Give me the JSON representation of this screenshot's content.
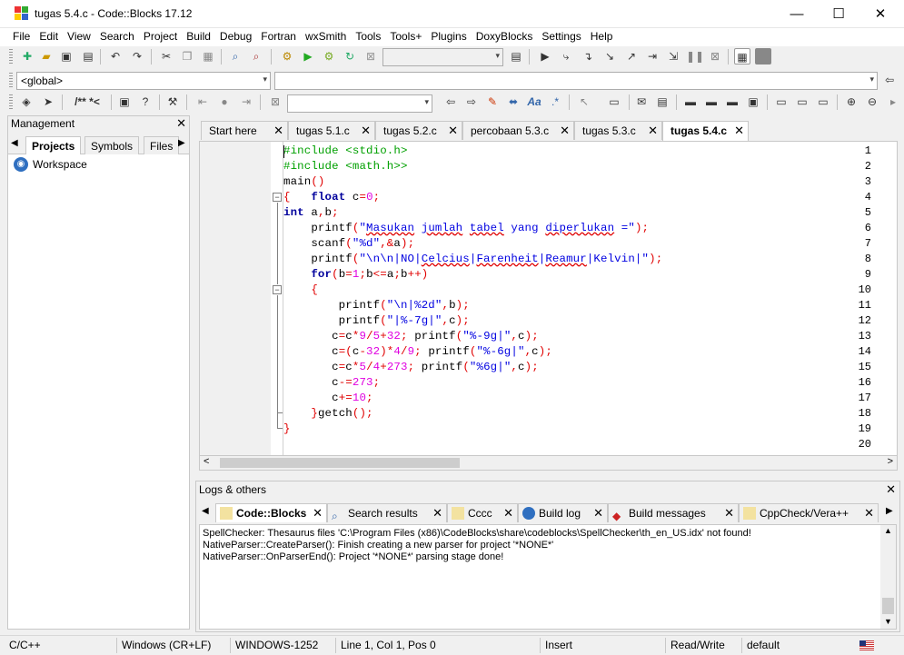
{
  "window": {
    "title": "tugas 5.4.c - Code::Blocks 17.12",
    "minimize": "—",
    "maximize": "☐",
    "close": "✕"
  },
  "menu": [
    "File",
    "Edit",
    "View",
    "Search",
    "Project",
    "Build",
    "Debug",
    "Fortran",
    "wxSmith",
    "Tools",
    "Tools+",
    "Plugins",
    "DoxyBlocks",
    "Settings",
    "Help"
  ],
  "toolbar": {
    "scope_value": "<global>",
    "comment_btn": "/** *<"
  },
  "management": {
    "title": "Management",
    "close": "✕",
    "tabs": [
      "Projects",
      "Symbols",
      "Files"
    ],
    "workspace": "Workspace"
  },
  "editor_tabs": [
    "Start here",
    "tugas 5.1.c",
    "tugas 5.2.c",
    "percobaan 5.3.c",
    "tugas 5.3.c",
    "tugas 5.4.c"
  ],
  "active_tab_index": 5,
  "code": {
    "line_numbers": [
      "1",
      "2",
      "3",
      "4",
      "5",
      "6",
      "7",
      "8",
      "9",
      "10",
      "11",
      "12",
      "13",
      "14",
      "15",
      "16",
      "17",
      "18",
      "19",
      "20"
    ]
  },
  "logs": {
    "title": "Logs & others",
    "close": "✕",
    "tabs": [
      "Code::Blocks",
      "Search results",
      "Cccc",
      "Build log",
      "Build messages",
      "CppCheck/Vera++"
    ],
    "lines": [
      "SpellChecker: Thesaurus files 'C:\\Program Files (x86)\\CodeBlocks\\share\\codeblocks\\SpellChecker\\th_en_US.idx' not found!",
      "NativeParser::CreateParser(): Finish creating a new parser for project '*NONE*'",
      "NativeParser::OnParserEnd(): Project '*NONE*' parsing stage done!"
    ]
  },
  "status": {
    "language": "C/C++",
    "eol": "Windows (CR+LF)",
    "encoding": "WINDOWS-1252",
    "position": "Line 1, Col 1, Pos 0",
    "mode": "Insert",
    "access": "Read/Write",
    "profile": "default"
  },
  "colors": {
    "preprocessor": "#00a000",
    "keyword": "#00009c",
    "number": "#e000e0",
    "string": "#0000e0",
    "operator": "#e00000"
  }
}
